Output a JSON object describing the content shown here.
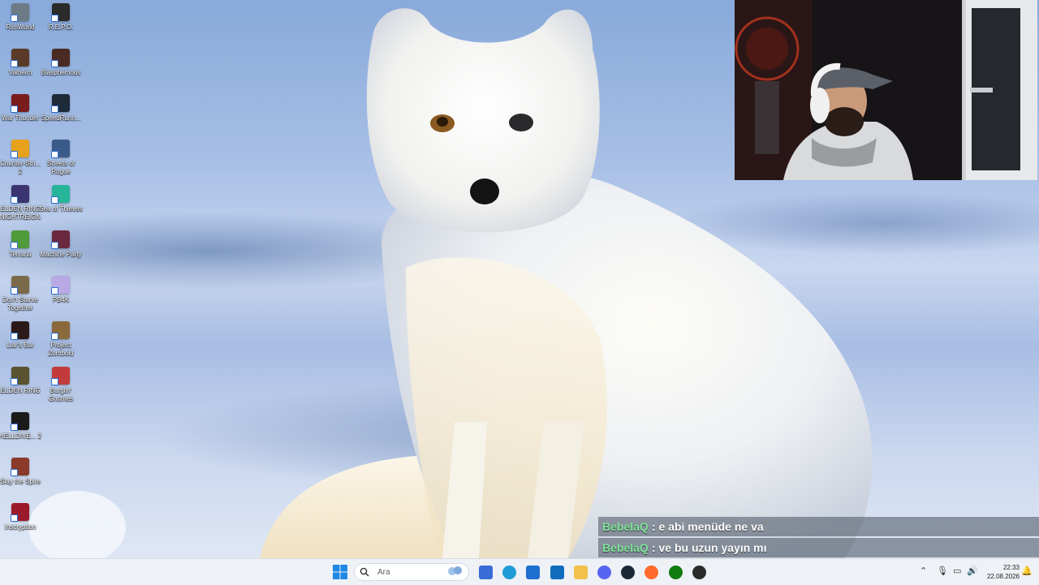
{
  "desktop_icons": [
    {
      "label": "RimWorld",
      "icon": "rimworld-icon",
      "color": "#6d7b86"
    },
    {
      "label": "R.E.P.O.",
      "icon": "repo-icon",
      "color": "#2b2b2b"
    },
    {
      "label": "Valheim",
      "icon": "valheim-icon",
      "color": "#5a3b28"
    },
    {
      "label": "Blasphemous",
      "icon": "blasphemous-icon",
      "color": "#4a2a22"
    },
    {
      "label": "War Thunder",
      "icon": "war-thunder-icon",
      "color": "#7a1d1d"
    },
    {
      "label": "SpeedRunn...",
      "icon": "speedrunners-icon",
      "color": "#1c2a3a"
    },
    {
      "label": "Counter-Stri... 2",
      "icon": "counter-strike-icon",
      "color": "#e6a21c"
    },
    {
      "label": "Streets of Rogue",
      "icon": "streets-of-rogue-icon",
      "color": "#3a5a8a"
    },
    {
      "label": "ELDEN RING NIGHTREIGN",
      "icon": "elden-ring-nightreign-icon",
      "color": "#3b3470"
    },
    {
      "label": "Sea of Thieves",
      "icon": "sea-of-thieves-icon",
      "color": "#27b59a"
    },
    {
      "label": "Terraria",
      "icon": "terraria-icon",
      "color": "#4f9a3a"
    },
    {
      "label": "Machine Party",
      "icon": "machine-party-icon",
      "color": "#6b2940"
    },
    {
      "label": "Don't Starve Together",
      "icon": "dont-starve-together-icon",
      "color": "#7a6a4a"
    },
    {
      "label": "PB4K",
      "icon": "pb4k-icon",
      "color": "#b8a8e6"
    },
    {
      "label": "Liar's Bar",
      "icon": "liars-bar-icon",
      "color": "#2a1a1a"
    },
    {
      "label": "Project Zomboid",
      "icon": "project-zomboid-icon",
      "color": "#8a6a3a"
    },
    {
      "label": "ELDEN RING",
      "icon": "elden-ring-icon",
      "color": "#5a5330"
    },
    {
      "label": "Burglin' Gnomes",
      "icon": "burglin-gnomes-icon",
      "color": "#c23a3a"
    },
    {
      "label": "HELLDIVE... 2",
      "icon": "helldivers-icon",
      "color": "#1a1a1a"
    },
    {
      "label": "",
      "icon": "blank",
      "color": ""
    },
    {
      "label": "Slay the Spire",
      "icon": "slay-the-spire-icon",
      "color": "#8a3a2a"
    },
    {
      "label": "",
      "icon": "blank",
      "color": ""
    },
    {
      "label": "Inscryption",
      "icon": "inscryption-icon",
      "color": "#9a1a2a"
    }
  ],
  "chat": [
    {
      "user": "BebelaQ",
      "sep": ":",
      "message": "e abi menüde ne va"
    },
    {
      "user": "BebelaQ",
      "sep": ":",
      "message": "ve bu uzun yayın mı"
    }
  ],
  "taskbar": {
    "search_placeholder": "Ara",
    "apps": [
      {
        "name": "widgets-news-icon",
        "color": "#3a6bd6"
      },
      {
        "name": "edge-icon",
        "color": "#1f9bd6"
      },
      {
        "name": "store-icon",
        "color": "#1f6fd0"
      },
      {
        "name": "outlook-icon",
        "color": "#0f6cbd"
      },
      {
        "name": "file-explorer-icon",
        "color": "#f2c14b"
      },
      {
        "name": "discord-icon",
        "color": "#5865f2"
      },
      {
        "name": "steam-icon",
        "color": "#1b2838"
      },
      {
        "name": "firefox-icon",
        "color": "#ff6a2a"
      },
      {
        "name": "xbox-icon",
        "color": "#107c10"
      },
      {
        "name": "obs-icon",
        "color": "#2a2a2a"
      }
    ],
    "time": "22:33",
    "date": "22.08.2026"
  }
}
